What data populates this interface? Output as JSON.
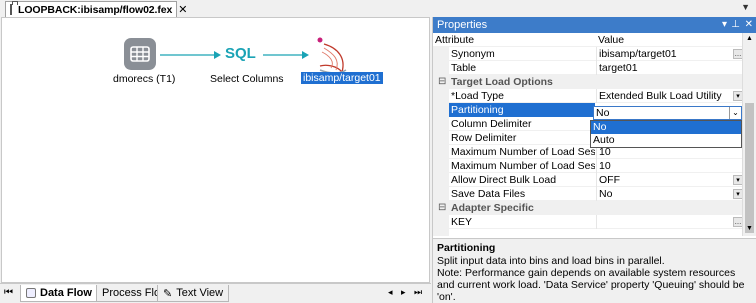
{
  "document_tab": {
    "title": "LOOPBACK:ibisamp/flow02.fex",
    "close": "✕"
  },
  "flow": {
    "source": {
      "label": "dmorecs (T1)"
    },
    "transform": {
      "icon_text": "SQL",
      "label": "Select Columns"
    },
    "target": {
      "label": "ibisamp/target01"
    }
  },
  "bottom_tabs": [
    {
      "label": "Data Flow"
    },
    {
      "label": "Process Flow"
    },
    {
      "label": "Text View"
    }
  ],
  "properties": {
    "title": "Properties",
    "columns": {
      "attribute": "Attribute",
      "value": "Value"
    },
    "rows": [
      {
        "attr": "Synonym",
        "value": "ibisamp/target01"
      },
      {
        "attr": "Table",
        "value": "target01"
      },
      {
        "attr": "Target Load Options",
        "value": ""
      },
      {
        "attr": "*Load Type",
        "value": "Extended Bulk Load Utility"
      },
      {
        "attr": "Partitioning",
        "value": "No"
      },
      {
        "attr": "Column Delimiter",
        "value": ""
      },
      {
        "attr": "Row Delimiter",
        "value": ""
      },
      {
        "attr": "Maximum Number of Load Sessio...",
        "value": "10"
      },
      {
        "attr": "Maximum Number of Load Sessio...",
        "value": "10"
      },
      {
        "attr": "Allow Direct Bulk Load",
        "value": "OFF"
      },
      {
        "attr": "Save Data Files",
        "value": "No"
      },
      {
        "attr": "Adapter Specific",
        "value": ""
      },
      {
        "attr": "KEY",
        "value": ""
      }
    ],
    "dropdown": {
      "selected": "No",
      "options": [
        "No",
        "Auto"
      ]
    },
    "description": {
      "heading": "Partitioning",
      "line1": "Split input data into bins and load bins in parallel.",
      "line2": "Note: Performance gain depends on available system resources and current work load. 'Data Service' property 'Queuing' should be 'on'."
    }
  },
  "colors": {
    "accent": "#3d7cc9",
    "selection": "#1f6fd1",
    "sql_teal": "#1aa3b5",
    "target_red": "#c0392b"
  }
}
